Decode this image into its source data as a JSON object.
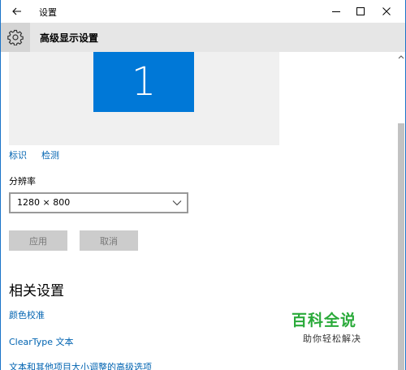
{
  "window": {
    "app_title": "设置"
  },
  "header": {
    "title": "高级显示设置",
    "icon": "gear-icon"
  },
  "display": {
    "monitor_number": "1",
    "identify_link": "标识",
    "detect_link": "检测"
  },
  "resolution": {
    "label": "分辨率",
    "selected_value": "1280 × 800"
  },
  "actions": {
    "apply_label": "应用",
    "cancel_label": "取消"
  },
  "related": {
    "title": "相关设置",
    "links": [
      "颜色校准",
      "ClearType 文本",
      "文本和其他项目大小调整的高级选项"
    ]
  },
  "watermark": {
    "brand": "百科全说",
    "tagline": "助你轻松解决"
  },
  "colors": {
    "accent": "#0078d7",
    "link": "#0063b1",
    "header_bg": "#e6e6e6",
    "watermark_green": "#2aaa3a"
  }
}
